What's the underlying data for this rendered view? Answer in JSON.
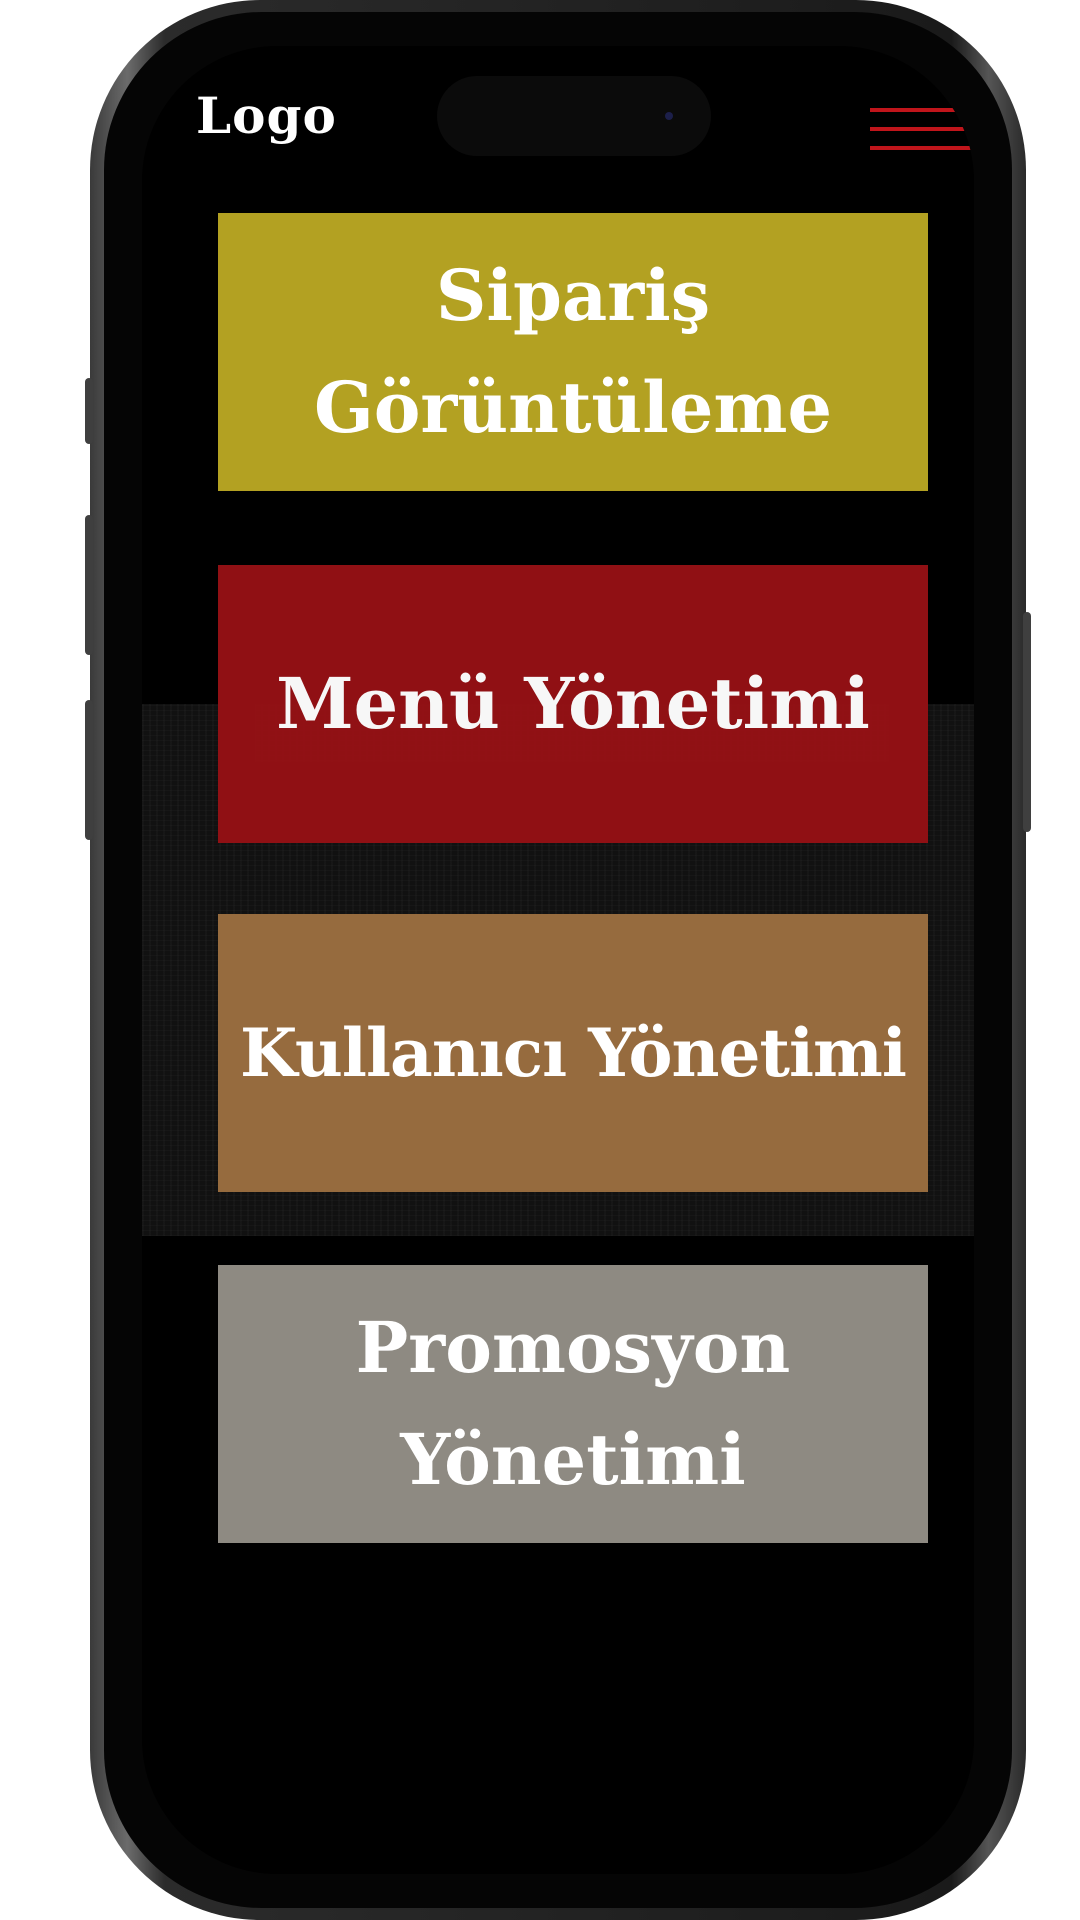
{
  "header": {
    "logo_text": "Logo",
    "menu_icon": "hamburger-menu-icon",
    "menu_icon_color": "#c0151b"
  },
  "tiles": [
    {
      "label": "Sipariş\nGörüntüleme",
      "color": "#b3a122"
    },
    {
      "label": "Menü Yönetimi",
      "color": "#951115"
    },
    {
      "label": "Kullanıcı Yönetimi",
      "color": "#966b3e"
    },
    {
      "label": "Promosyon\nYönetimi",
      "color": "#8e8a82"
    }
  ],
  "colors": {
    "screen_background": "#000000"
  }
}
